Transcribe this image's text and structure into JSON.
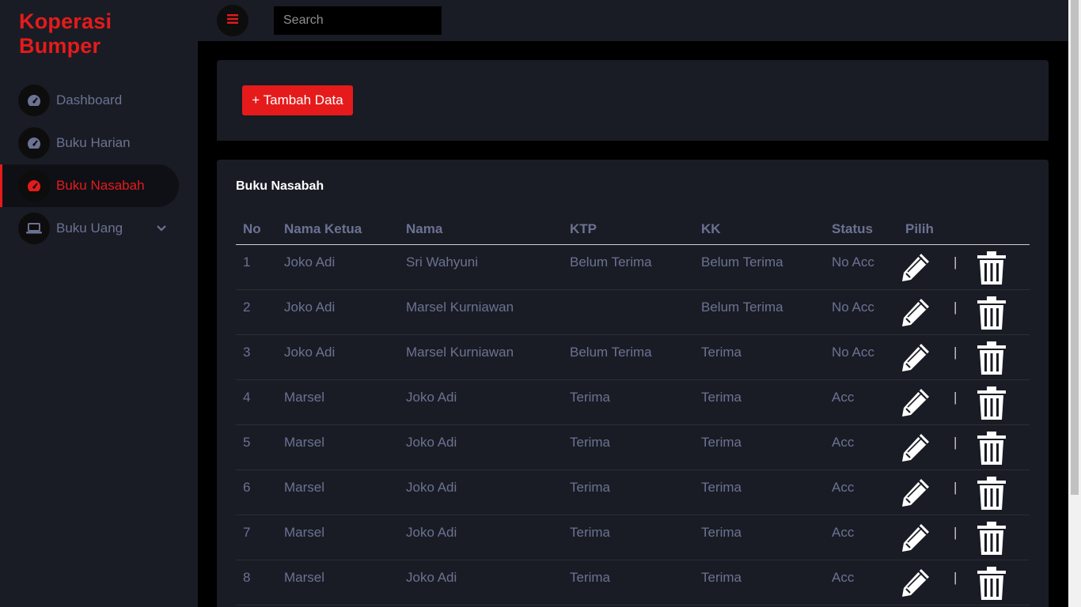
{
  "brand": "Koperasi Bumper",
  "search": {
    "placeholder": "Search"
  },
  "sidebar": {
    "items": [
      {
        "label": "Dashboard",
        "icon": "speedometer-icon",
        "active": false
      },
      {
        "label": "Buku Harian",
        "icon": "speedometer-icon",
        "active": false
      },
      {
        "label": "Buku Nasabah",
        "icon": "speedometer-icon",
        "active": true
      },
      {
        "label": "Buku Uang",
        "icon": "laptop-icon",
        "active": false,
        "has_submenu": true
      }
    ]
  },
  "toolbar": {
    "add_label": "+ Tambah Data"
  },
  "table": {
    "title": "Buku Nasabah",
    "headers": [
      "No",
      "Nama Ketua",
      "Nama",
      "KTP",
      "KK",
      "Status",
      "Pilih"
    ],
    "separator": "|",
    "rows": [
      [
        "1",
        "Joko Adi",
        "Sri Wahyuni",
        "Belum Terima",
        "Belum Terima",
        "No Acc"
      ],
      [
        "2",
        "Joko Adi",
        "Marsel Kurniawan",
        "",
        "Belum Terima",
        "No Acc"
      ],
      [
        "3",
        "Joko Adi",
        "Marsel Kurniawan",
        "Belum Terima",
        "Terima",
        "No Acc"
      ],
      [
        "4",
        "Marsel",
        "Joko Adi",
        "Terima",
        "Terima",
        "Acc"
      ],
      [
        "5",
        "Marsel",
        "Joko Adi",
        "Terima",
        "Terima",
        "Acc"
      ],
      [
        "6",
        "Marsel",
        "Joko Adi",
        "Terima",
        "Terima",
        "Acc"
      ],
      [
        "7",
        "Marsel",
        "Joko Adi",
        "Terima",
        "Terima",
        "Acc"
      ],
      [
        "8",
        "Marsel",
        "Joko Adi",
        "Terima",
        "Terima",
        "Acc"
      ]
    ]
  },
  "colors": {
    "accent": "#e51b1b",
    "sidebar_bg": "#191c24",
    "page_bg": "#000000",
    "muted_text": "#6c7293"
  }
}
